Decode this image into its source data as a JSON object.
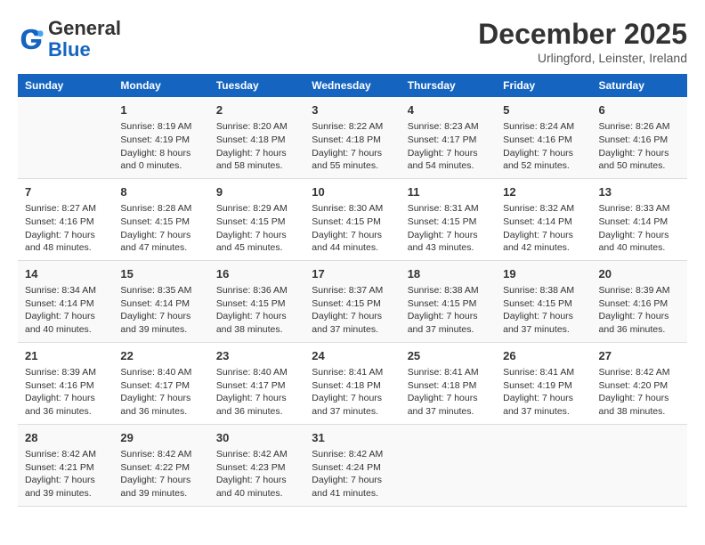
{
  "header": {
    "logo_line1": "General",
    "logo_line2": "Blue",
    "month": "December 2025",
    "location": "Urlingford, Leinster, Ireland"
  },
  "weekdays": [
    "Sunday",
    "Monday",
    "Tuesday",
    "Wednesday",
    "Thursday",
    "Friday",
    "Saturday"
  ],
  "weeks": [
    [
      {
        "day": "",
        "content": ""
      },
      {
        "day": "1",
        "content": "Sunrise: 8:19 AM\nSunset: 4:19 PM\nDaylight: 8 hours\nand 0 minutes."
      },
      {
        "day": "2",
        "content": "Sunrise: 8:20 AM\nSunset: 4:18 PM\nDaylight: 7 hours\nand 58 minutes."
      },
      {
        "day": "3",
        "content": "Sunrise: 8:22 AM\nSunset: 4:18 PM\nDaylight: 7 hours\nand 55 minutes."
      },
      {
        "day": "4",
        "content": "Sunrise: 8:23 AM\nSunset: 4:17 PM\nDaylight: 7 hours\nand 54 minutes."
      },
      {
        "day": "5",
        "content": "Sunrise: 8:24 AM\nSunset: 4:16 PM\nDaylight: 7 hours\nand 52 minutes."
      },
      {
        "day": "6",
        "content": "Sunrise: 8:26 AM\nSunset: 4:16 PM\nDaylight: 7 hours\nand 50 minutes."
      }
    ],
    [
      {
        "day": "7",
        "content": "Sunrise: 8:27 AM\nSunset: 4:16 PM\nDaylight: 7 hours\nand 48 minutes."
      },
      {
        "day": "8",
        "content": "Sunrise: 8:28 AM\nSunset: 4:15 PM\nDaylight: 7 hours\nand 47 minutes."
      },
      {
        "day": "9",
        "content": "Sunrise: 8:29 AM\nSunset: 4:15 PM\nDaylight: 7 hours\nand 45 minutes."
      },
      {
        "day": "10",
        "content": "Sunrise: 8:30 AM\nSunset: 4:15 PM\nDaylight: 7 hours\nand 44 minutes."
      },
      {
        "day": "11",
        "content": "Sunrise: 8:31 AM\nSunset: 4:15 PM\nDaylight: 7 hours\nand 43 minutes."
      },
      {
        "day": "12",
        "content": "Sunrise: 8:32 AM\nSunset: 4:14 PM\nDaylight: 7 hours\nand 42 minutes."
      },
      {
        "day": "13",
        "content": "Sunrise: 8:33 AM\nSunset: 4:14 PM\nDaylight: 7 hours\nand 40 minutes."
      }
    ],
    [
      {
        "day": "14",
        "content": "Sunrise: 8:34 AM\nSunset: 4:14 PM\nDaylight: 7 hours\nand 40 minutes."
      },
      {
        "day": "15",
        "content": "Sunrise: 8:35 AM\nSunset: 4:14 PM\nDaylight: 7 hours\nand 39 minutes."
      },
      {
        "day": "16",
        "content": "Sunrise: 8:36 AM\nSunset: 4:15 PM\nDaylight: 7 hours\nand 38 minutes."
      },
      {
        "day": "17",
        "content": "Sunrise: 8:37 AM\nSunset: 4:15 PM\nDaylight: 7 hours\nand 37 minutes."
      },
      {
        "day": "18",
        "content": "Sunrise: 8:38 AM\nSunset: 4:15 PM\nDaylight: 7 hours\nand 37 minutes."
      },
      {
        "day": "19",
        "content": "Sunrise: 8:38 AM\nSunset: 4:15 PM\nDaylight: 7 hours\nand 37 minutes."
      },
      {
        "day": "20",
        "content": "Sunrise: 8:39 AM\nSunset: 4:16 PM\nDaylight: 7 hours\nand 36 minutes."
      }
    ],
    [
      {
        "day": "21",
        "content": "Sunrise: 8:39 AM\nSunset: 4:16 PM\nDaylight: 7 hours\nand 36 minutes."
      },
      {
        "day": "22",
        "content": "Sunrise: 8:40 AM\nSunset: 4:17 PM\nDaylight: 7 hours\nand 36 minutes."
      },
      {
        "day": "23",
        "content": "Sunrise: 8:40 AM\nSunset: 4:17 PM\nDaylight: 7 hours\nand 36 minutes."
      },
      {
        "day": "24",
        "content": "Sunrise: 8:41 AM\nSunset: 4:18 PM\nDaylight: 7 hours\nand 37 minutes."
      },
      {
        "day": "25",
        "content": "Sunrise: 8:41 AM\nSunset: 4:18 PM\nDaylight: 7 hours\nand 37 minutes."
      },
      {
        "day": "26",
        "content": "Sunrise: 8:41 AM\nSunset: 4:19 PM\nDaylight: 7 hours\nand 37 minutes."
      },
      {
        "day": "27",
        "content": "Sunrise: 8:42 AM\nSunset: 4:20 PM\nDaylight: 7 hours\nand 38 minutes."
      }
    ],
    [
      {
        "day": "28",
        "content": "Sunrise: 8:42 AM\nSunset: 4:21 PM\nDaylight: 7 hours\nand 39 minutes."
      },
      {
        "day": "29",
        "content": "Sunrise: 8:42 AM\nSunset: 4:22 PM\nDaylight: 7 hours\nand 39 minutes."
      },
      {
        "day": "30",
        "content": "Sunrise: 8:42 AM\nSunset: 4:23 PM\nDaylight: 7 hours\nand 40 minutes."
      },
      {
        "day": "31",
        "content": "Sunrise: 8:42 AM\nSunset: 4:24 PM\nDaylight: 7 hours\nand 41 minutes."
      },
      {
        "day": "",
        "content": ""
      },
      {
        "day": "",
        "content": ""
      },
      {
        "day": "",
        "content": ""
      }
    ]
  ]
}
